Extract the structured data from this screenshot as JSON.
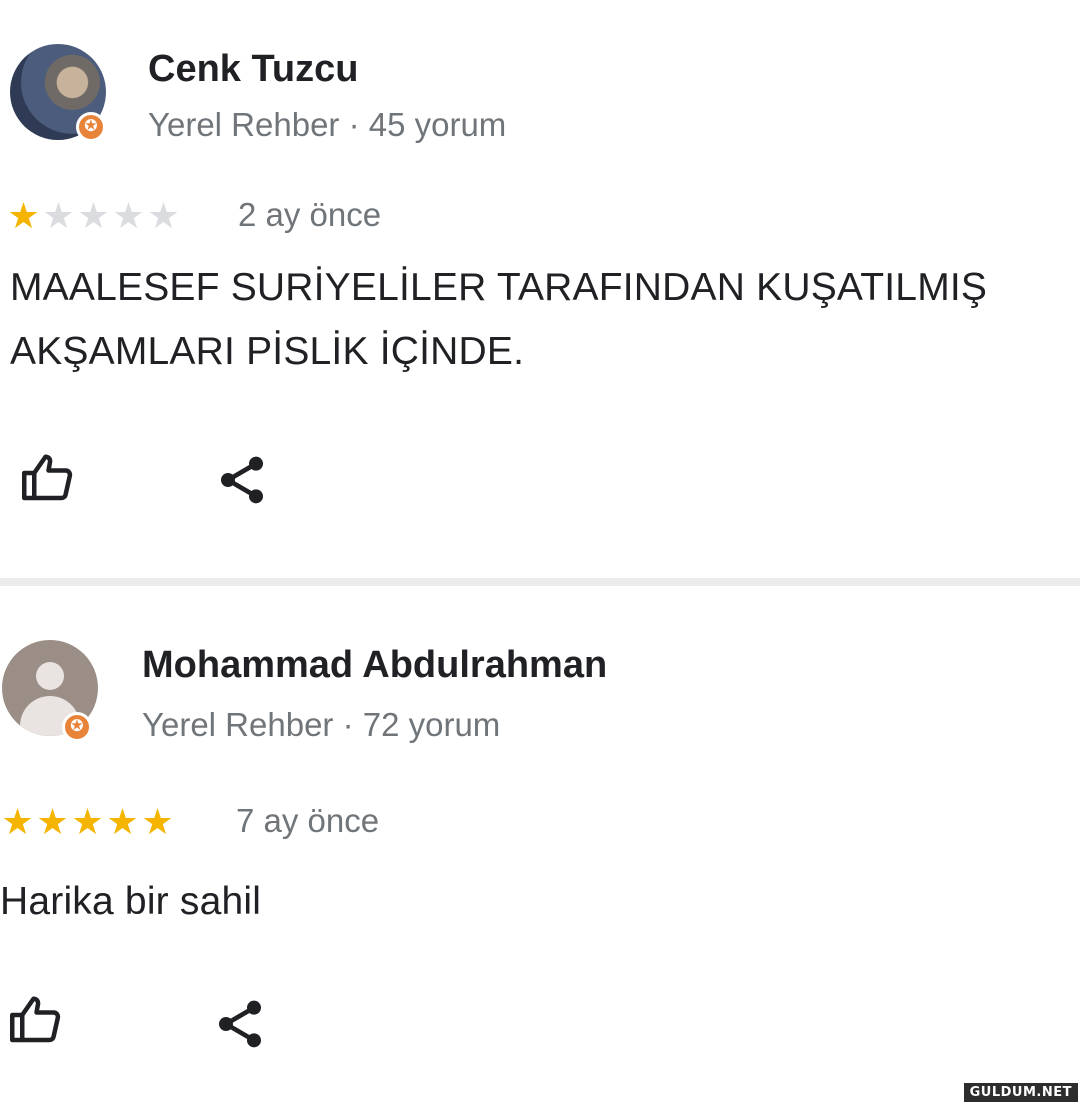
{
  "reviews": [
    {
      "author": "Cenk Tuzcu",
      "meta": "Yerel Rehber · 45 yorum",
      "rating": 1,
      "max_rating": 5,
      "time": "2 ay önce",
      "text": "MAALESEF SURİYELİLER TARAFINDAN KUŞATILMIŞ AKŞAMLARI PİSLİK İÇİNDE.",
      "avatar": "photo",
      "icons": {
        "like": "thumbs-up-icon",
        "share": "share-icon"
      }
    },
    {
      "author": "Mohammad Abdulrahman",
      "meta": "Yerel Rehber · 72 yorum",
      "rating": 5,
      "max_rating": 5,
      "time": "7 ay önce",
      "text": "Harika bir sahil",
      "avatar": "default",
      "icons": {
        "like": "thumbs-up-icon",
        "share": "share-icon"
      }
    }
  ],
  "watermark": "GULDUM.NET",
  "colors": {
    "star_on": "#f4b400",
    "star_off": "#dadce0",
    "badge": "#e8833a"
  }
}
